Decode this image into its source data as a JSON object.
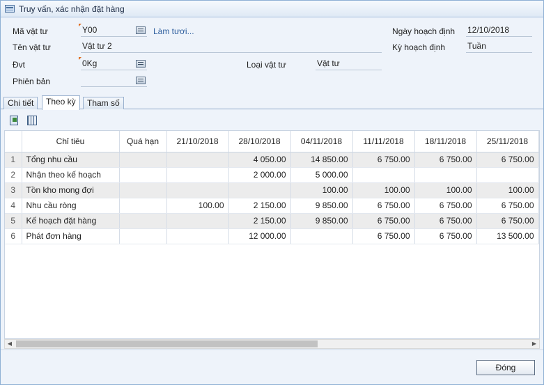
{
  "window": {
    "title": "Truy vấn, xác nhận đặt hàng",
    "icon": "window-icon"
  },
  "form": {
    "item_code_label": "Mã vật tư",
    "item_code_value": "Y00",
    "refresh_label": "Làm tươi...",
    "item_name_label": "Tên vật tư",
    "item_name_value": "Vật tư 2",
    "unit_label": "Đvt",
    "unit_value": "0Kg",
    "version_label": "Phiên bản",
    "version_value": "",
    "item_type_label": "Loại vật tư",
    "item_type_value": "Vật tư",
    "plan_date_label": "Ngày hoạch định",
    "plan_date_value": "12/10/2018",
    "plan_period_label": "Kỳ hoạch định",
    "plan_period_value": "Tuần"
  },
  "tabs": [
    {
      "label": "Chi tiết"
    },
    {
      "label": "Theo kỳ",
      "active": true
    },
    {
      "label": "Tham số"
    }
  ],
  "toolbar": {
    "export_icon": "export-icon",
    "columns_icon": "columns-icon"
  },
  "grid": {
    "columns": [
      "",
      "Chỉ tiêu",
      "Quá hạn",
      "21/10/2018",
      "28/10/2018",
      "04/11/2018",
      "11/11/2018",
      "18/11/2018",
      "25/11/2018"
    ],
    "rows": [
      [
        "1",
        "Tổng nhu cầu",
        "",
        "",
        "4 050.00",
        "14 850.00",
        "6 750.00",
        "6 750.00",
        "6 750.00"
      ],
      [
        "2",
        "Nhận theo kế hoạch",
        "",
        "",
        "2 000.00",
        "5 000.00",
        "",
        "",
        ""
      ],
      [
        "3",
        "Tồn kho mong đợi",
        "",
        "",
        "",
        "100.00",
        "100.00",
        "100.00",
        "100.00"
      ],
      [
        "4",
        "Nhu cầu ròng",
        "",
        "100.00",
        "2 150.00",
        "9 850.00",
        "6 750.00",
        "6 750.00",
        "6 750.00"
      ],
      [
        "5",
        "Kế hoạch đặt hàng",
        "",
        "",
        "2 150.00",
        "9 850.00",
        "6 750.00",
        "6 750.00",
        "6 750.00"
      ],
      [
        "6",
        "Phát đơn hàng",
        "",
        "",
        "12 000.00",
        "",
        "6 750.00",
        "6 750.00",
        "13 500.00"
      ]
    ]
  },
  "footer": {
    "close_label": "Đóng"
  }
}
